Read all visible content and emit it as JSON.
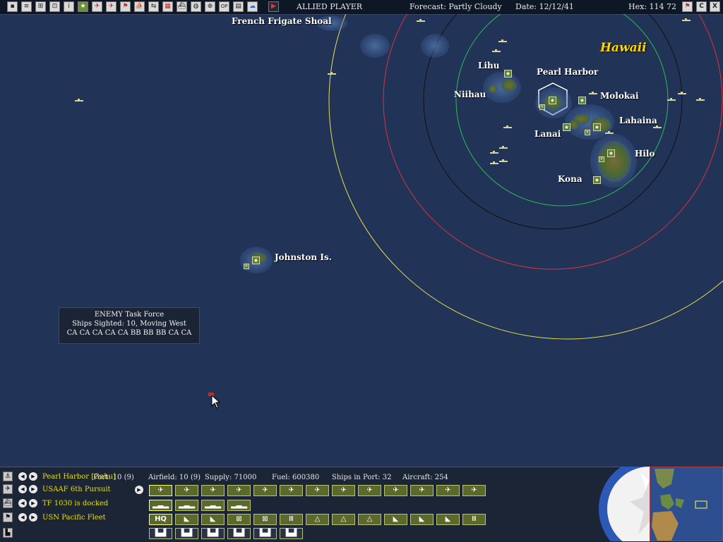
{
  "topbar": {
    "player": "ALLIED PLAYER",
    "forecast": "Forecast: Partly Cloudy",
    "date": "Date: 12/12/41",
    "hex": "Hex: 114  72",
    "right_button_c": "C",
    "right_button_x": "X",
    "left_button_op": "OP"
  },
  "map": {
    "region_title": "Hawaii",
    "labels": {
      "french_frigate_shoal": "French Frigate Shoal",
      "lihu": "Lihu",
      "niihau": "Niihau",
      "pearl_harbor": "Pearl Harbor",
      "molokai": "Molokai",
      "lanai": "Lanai",
      "lahaina": "Lahaina",
      "hilo": "Hilo",
      "kona": "Kona",
      "johnston": "Johnston Is."
    },
    "tooltip": {
      "line1": "ENEMY Task Force",
      "line2": "Ships Sighted: 10, Moving West",
      "line3": "CA CA CA CA CA BB BB BB CA CA"
    },
    "ring_colors": {
      "yellow": "#e8e04a",
      "red": "#d8343c",
      "black": "#101010",
      "green": "#28c050"
    }
  },
  "panel": {
    "rows": {
      "base": "Pearl Harbor [Oahu]",
      "air": "USAAF 6th Pursuit",
      "tf": "TF 1030 is docked",
      "hq": "USN Pacific Fleet"
    },
    "stats": {
      "port": "Port: 10 (9)",
      "airfield": "Airfield: 10 (9)",
      "supply": "Supply: 71000",
      "fuel": "Fuel: 600380",
      "ships": "Ships in Port: 32",
      "aircraft": "Aircraft: 254"
    },
    "hq_button": "HQ"
  },
  "icons": [
    "base-anchor-icon",
    "plane-icon",
    "ship-icon",
    "flag-icon",
    "factory-icon",
    "star-icon",
    "cursor-icon"
  ]
}
